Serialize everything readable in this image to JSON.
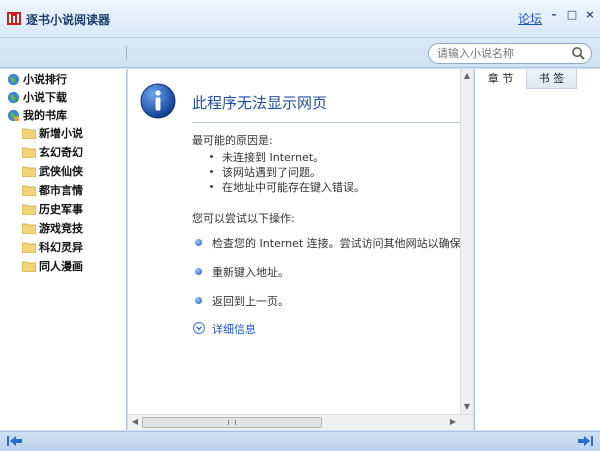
{
  "window": {
    "title": "逐书小说阅读器",
    "forum": "论坛",
    "minimize": "–",
    "maximize": "□",
    "close": "×"
  },
  "search": {
    "placeholder": "请输入小说名称"
  },
  "sidebar": {
    "items": [
      {
        "label": "小说排行"
      },
      {
        "label": "小说下载"
      },
      {
        "label": "我的书库"
      }
    ],
    "folders": [
      {
        "label": "新增小说"
      },
      {
        "label": "玄幻奇幻"
      },
      {
        "label": "武侠仙侠"
      },
      {
        "label": "都市言情"
      },
      {
        "label": "历史军事"
      },
      {
        "label": "游戏竞技"
      },
      {
        "label": "科幻灵异"
      },
      {
        "label": "同人漫画"
      }
    ]
  },
  "content": {
    "title": "此程序无法显示网页",
    "causes_heading": "最可能的原因是:",
    "causes": [
      "未连接到 Internet。",
      "该网站遇到了问题。",
      "在地址中可能存在键入错误。"
    ],
    "actions_heading": "您可以尝试以下操作:",
    "actions": [
      "检查您的 Internet 连接。尝试访问其他网站以确保已连",
      "重新键入地址。",
      "返回到上一页。"
    ],
    "details": "详细信息"
  },
  "right_panel": {
    "tabs": [
      {
        "label": "章 节"
      },
      {
        "label": "书 签"
      }
    ]
  },
  "colors": {
    "accent": "#1f4f9a",
    "frame": "#cfe0f3"
  },
  "icons": {
    "app": "book-logo-icon",
    "search": "magnifier-icon",
    "info": "info-icon",
    "back": "back-arrow-icon",
    "forward": "forward-arrow-icon"
  }
}
